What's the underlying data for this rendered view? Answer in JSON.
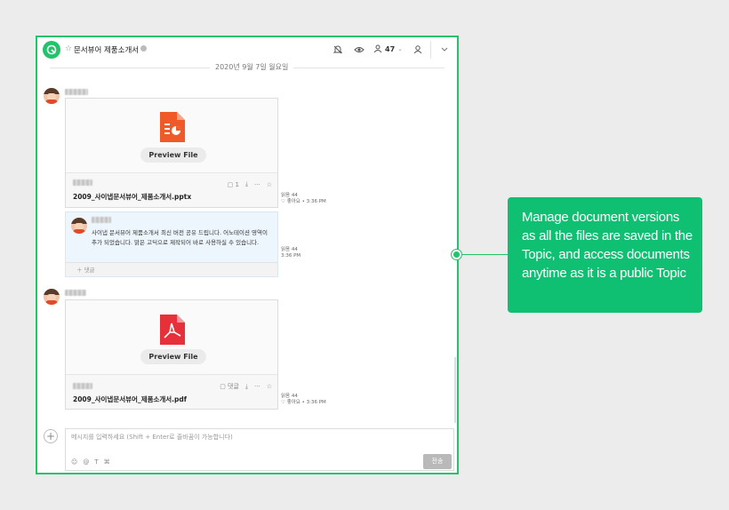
{
  "header": {
    "title": "문서뷰어 제품소개서",
    "member_count": "47"
  },
  "date_divider": "2020년 9월 7일 월요일",
  "messages": [
    {
      "file": {
        "preview_button": "Preview File",
        "name": "2009_사이냅문서뷰어_제품소개서.pptx",
        "comment_count": "1",
        "type": "pptx"
      },
      "read_label": "읽음 44",
      "like_label": "좋아요",
      "time": "3:36 PM"
    },
    {
      "comment": {
        "text": "사이냅 문서뷰어 제품소개서 최신 버전 공유 드립니다. 어노테이션 영역이 추가 되었습니다. 맑은 고딕으로 제작되어 바로 사용하실 수 있습니다.",
        "reply_label": "댓글"
      },
      "read_label": "읽음 44",
      "time": "3:36 PM"
    },
    {
      "file": {
        "preview_button": "Preview File",
        "name": "2009_사이냅문서뷰어_제품소개서.pdf",
        "comment_label": "댓글",
        "type": "pdf"
      },
      "read_label": "읽음 44",
      "like_label": "좋아요",
      "time": "3:36 PM"
    }
  ],
  "composer": {
    "placeholder": "메시지를 입력하세요 (Shift + Enter로 줄바꿈이 가능합니다)",
    "send_label": "전송"
  },
  "callout": {
    "text": "Manage document versions as all the files are saved in the Topic, and access documents anytime as it is a public Topic"
  },
  "colors": {
    "accent": "#22c36a",
    "callout_bg": "#0fc072",
    "pptx_icon": "#f05a28",
    "pdf_icon": "#e8303a"
  },
  "icons": [
    "topic-logo-icon",
    "star-icon",
    "info-icon",
    "bell-icon",
    "eye-icon",
    "member-icon",
    "add-member-icon",
    "chevron-down-icon",
    "comment-icon",
    "download-icon",
    "more-icon",
    "bookmark-star-icon",
    "like-icon",
    "plus-icon",
    "emoji-icon",
    "mention-icon",
    "text-format-icon",
    "integration-icon"
  ]
}
